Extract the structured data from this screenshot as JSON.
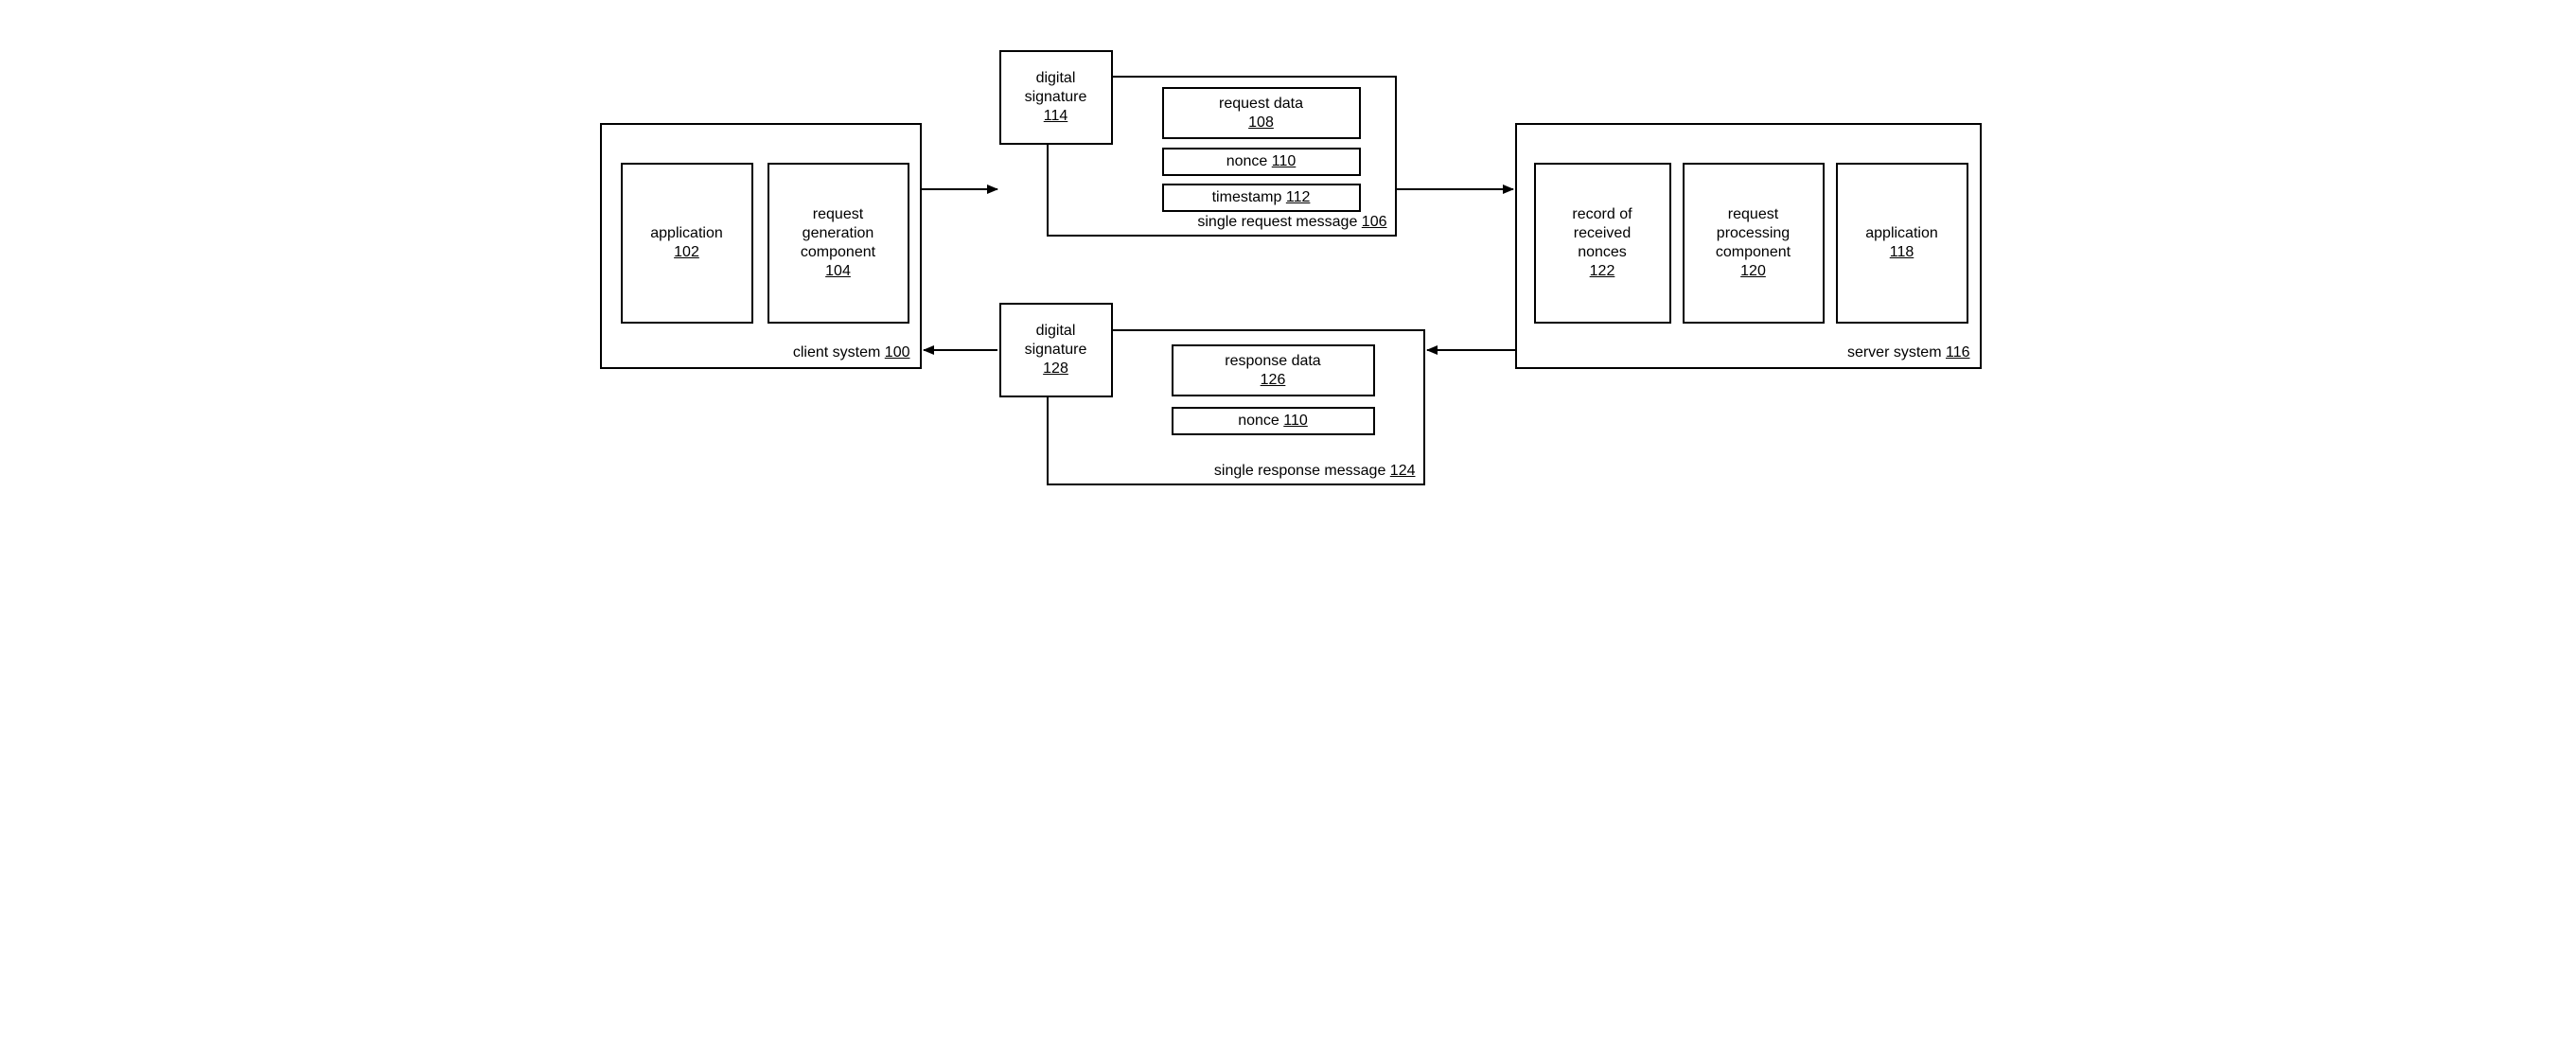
{
  "client": {
    "title_label": "client system",
    "title_num": "100",
    "app": {
      "label": "application",
      "num": "102"
    },
    "reqgen": {
      "label1": "request",
      "label2": "generation",
      "label3": "component",
      "num": "104"
    }
  },
  "server": {
    "title_label": "server system",
    "title_num": "116",
    "nonces": {
      "label1": "record of",
      "label2": "received",
      "label3": "nonces",
      "num": "122"
    },
    "reqproc": {
      "label1": "request",
      "label2": "processing",
      "label3": "component",
      "num": "120"
    },
    "app": {
      "label": "application",
      "num": "118"
    }
  },
  "req": {
    "title_label": "single request message",
    "title_num": "106",
    "sig": {
      "label1": "digital",
      "label2": "signature",
      "num": "114"
    },
    "data": {
      "label": "request data",
      "num": "108"
    },
    "nonce": {
      "label": "nonce",
      "num": "110"
    },
    "ts": {
      "label": "timestamp",
      "num": "112"
    }
  },
  "resp": {
    "title_label": "single response message",
    "title_num": "124",
    "sig": {
      "label1": "digital",
      "label2": "signature",
      "num": "128"
    },
    "data": {
      "label": "response data",
      "num": "126"
    },
    "nonce": {
      "label": "nonce",
      "num": "110"
    }
  }
}
